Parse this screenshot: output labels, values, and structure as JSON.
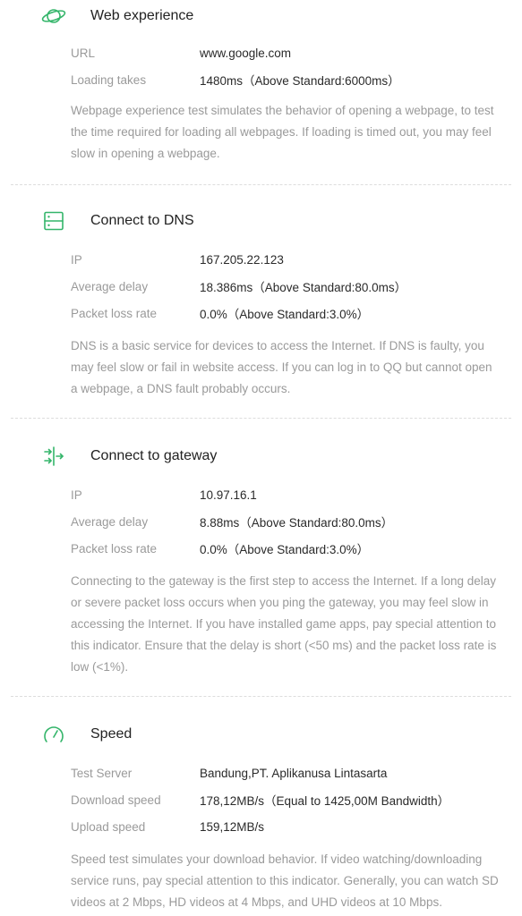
{
  "colors": {
    "accent": "#34b56a",
    "label": "#9a9a9a",
    "text": "#2a2a2a"
  },
  "sections": [
    {
      "icon": "planet-icon",
      "title": "Web experience",
      "rows": [
        {
          "label": "URL",
          "value": "www.google.com"
        },
        {
          "label": "Loading takes",
          "value": "1480ms（Above Standard:6000ms）"
        }
      ],
      "desc": "Webpage experience test simulates the behavior of opening a webpage, to test the time required for loading all webpages. If loading is timed out, you may feel slow in opening a webpage."
    },
    {
      "icon": "server-icon",
      "title": "Connect to DNS",
      "rows": [
        {
          "label": "IP",
          "value": "167.205.22.123"
        },
        {
          "label": "Average delay",
          "value": "18.386ms（Above Standard:80.0ms）"
        },
        {
          "label": "Packet loss rate",
          "value": "0.0%（Above Standard:3.0%）"
        }
      ],
      "desc": "DNS is a basic service for devices to access the Internet. If DNS is faulty, you may feel slow or fail in website access. If you can log in to QQ but cannot open a webpage, a DNS fault probably occurs."
    },
    {
      "icon": "gateway-icon",
      "title": "Connect to gateway",
      "rows": [
        {
          "label": "IP",
          "value": "10.97.16.1"
        },
        {
          "label": "Average delay",
          "value": "8.88ms（Above Standard:80.0ms）"
        },
        {
          "label": "Packet loss rate",
          "value": "0.0%（Above Standard:3.0%）"
        }
      ],
      "desc": "Connecting to the gateway is the first step to access the Internet. If a long delay or severe packet loss occurs when you ping the gateway, you may feel slow in accessing the Internet. If you have installed game apps, pay special attention to this indicator. Ensure that the delay is short (<50 ms) and the packet loss rate is low (<1%)."
    },
    {
      "icon": "speedometer-icon",
      "title": "Speed",
      "rows": [
        {
          "label": "Test Server",
          "value": "Bandung,PT. Aplikanusa Lintasarta"
        },
        {
          "label": "Download speed",
          "value": "178,12MB/s（Equal to 1425,00M Bandwidth）"
        },
        {
          "label": "Upload speed",
          "value": "159,12MB/s"
        }
      ],
      "desc": "Speed test simulates your download behavior. If video watching/downloading service runs, pay special attention to this indicator. Generally, you can watch SD videos at 2 Mbps, HD videos at 4 Mbps, and UHD videos at 10 Mbps."
    }
  ]
}
